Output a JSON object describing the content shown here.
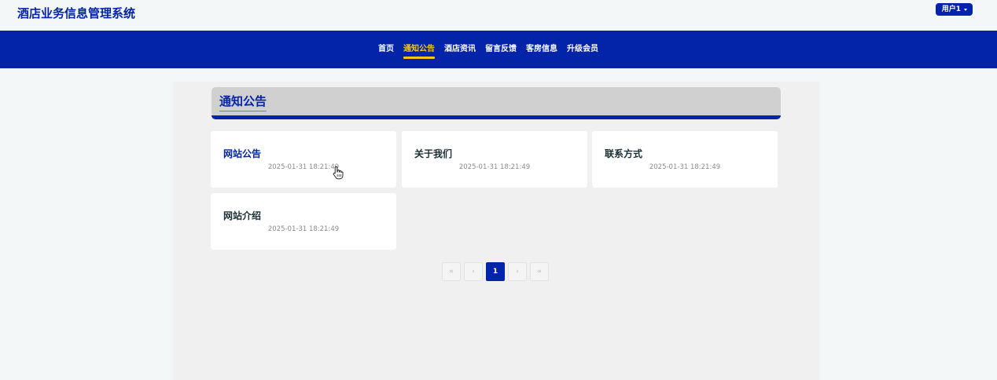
{
  "header": {
    "app_title": "酒店业务信息管理系统",
    "user_label": "用户1"
  },
  "nav": {
    "items": [
      {
        "label": "首页",
        "active": false
      },
      {
        "label": "通知公告",
        "active": true
      },
      {
        "label": "酒店资讯",
        "active": false
      },
      {
        "label": "留言反馈",
        "active": false
      },
      {
        "label": "客房信息",
        "active": false
      },
      {
        "label": "升级会员",
        "active": false
      }
    ]
  },
  "section": {
    "title": "通知公告"
  },
  "notices": [
    {
      "title": "网站公告",
      "date": "2025-01-31 18:21:49",
      "title_color": "#0324a8"
    },
    {
      "title": "关于我们",
      "date": "2025-01-31 18:21:49",
      "title_color": "#1a2e33"
    },
    {
      "title": "联系方式",
      "date": "2025-01-31 18:21:49",
      "title_color": "#1a2e33"
    },
    {
      "title": "网站介绍",
      "date": "2025-01-31 18:21:49",
      "title_color": "#1a2e33"
    }
  ],
  "pagination": {
    "first": "«",
    "prev": "‹",
    "current": "1",
    "next": "›",
    "last": "»"
  },
  "colors": {
    "brand": "#0324a8",
    "accent": "#f5c518",
    "page_bg": "#f3f7f8",
    "panel_bg": "#f0f0f0"
  }
}
